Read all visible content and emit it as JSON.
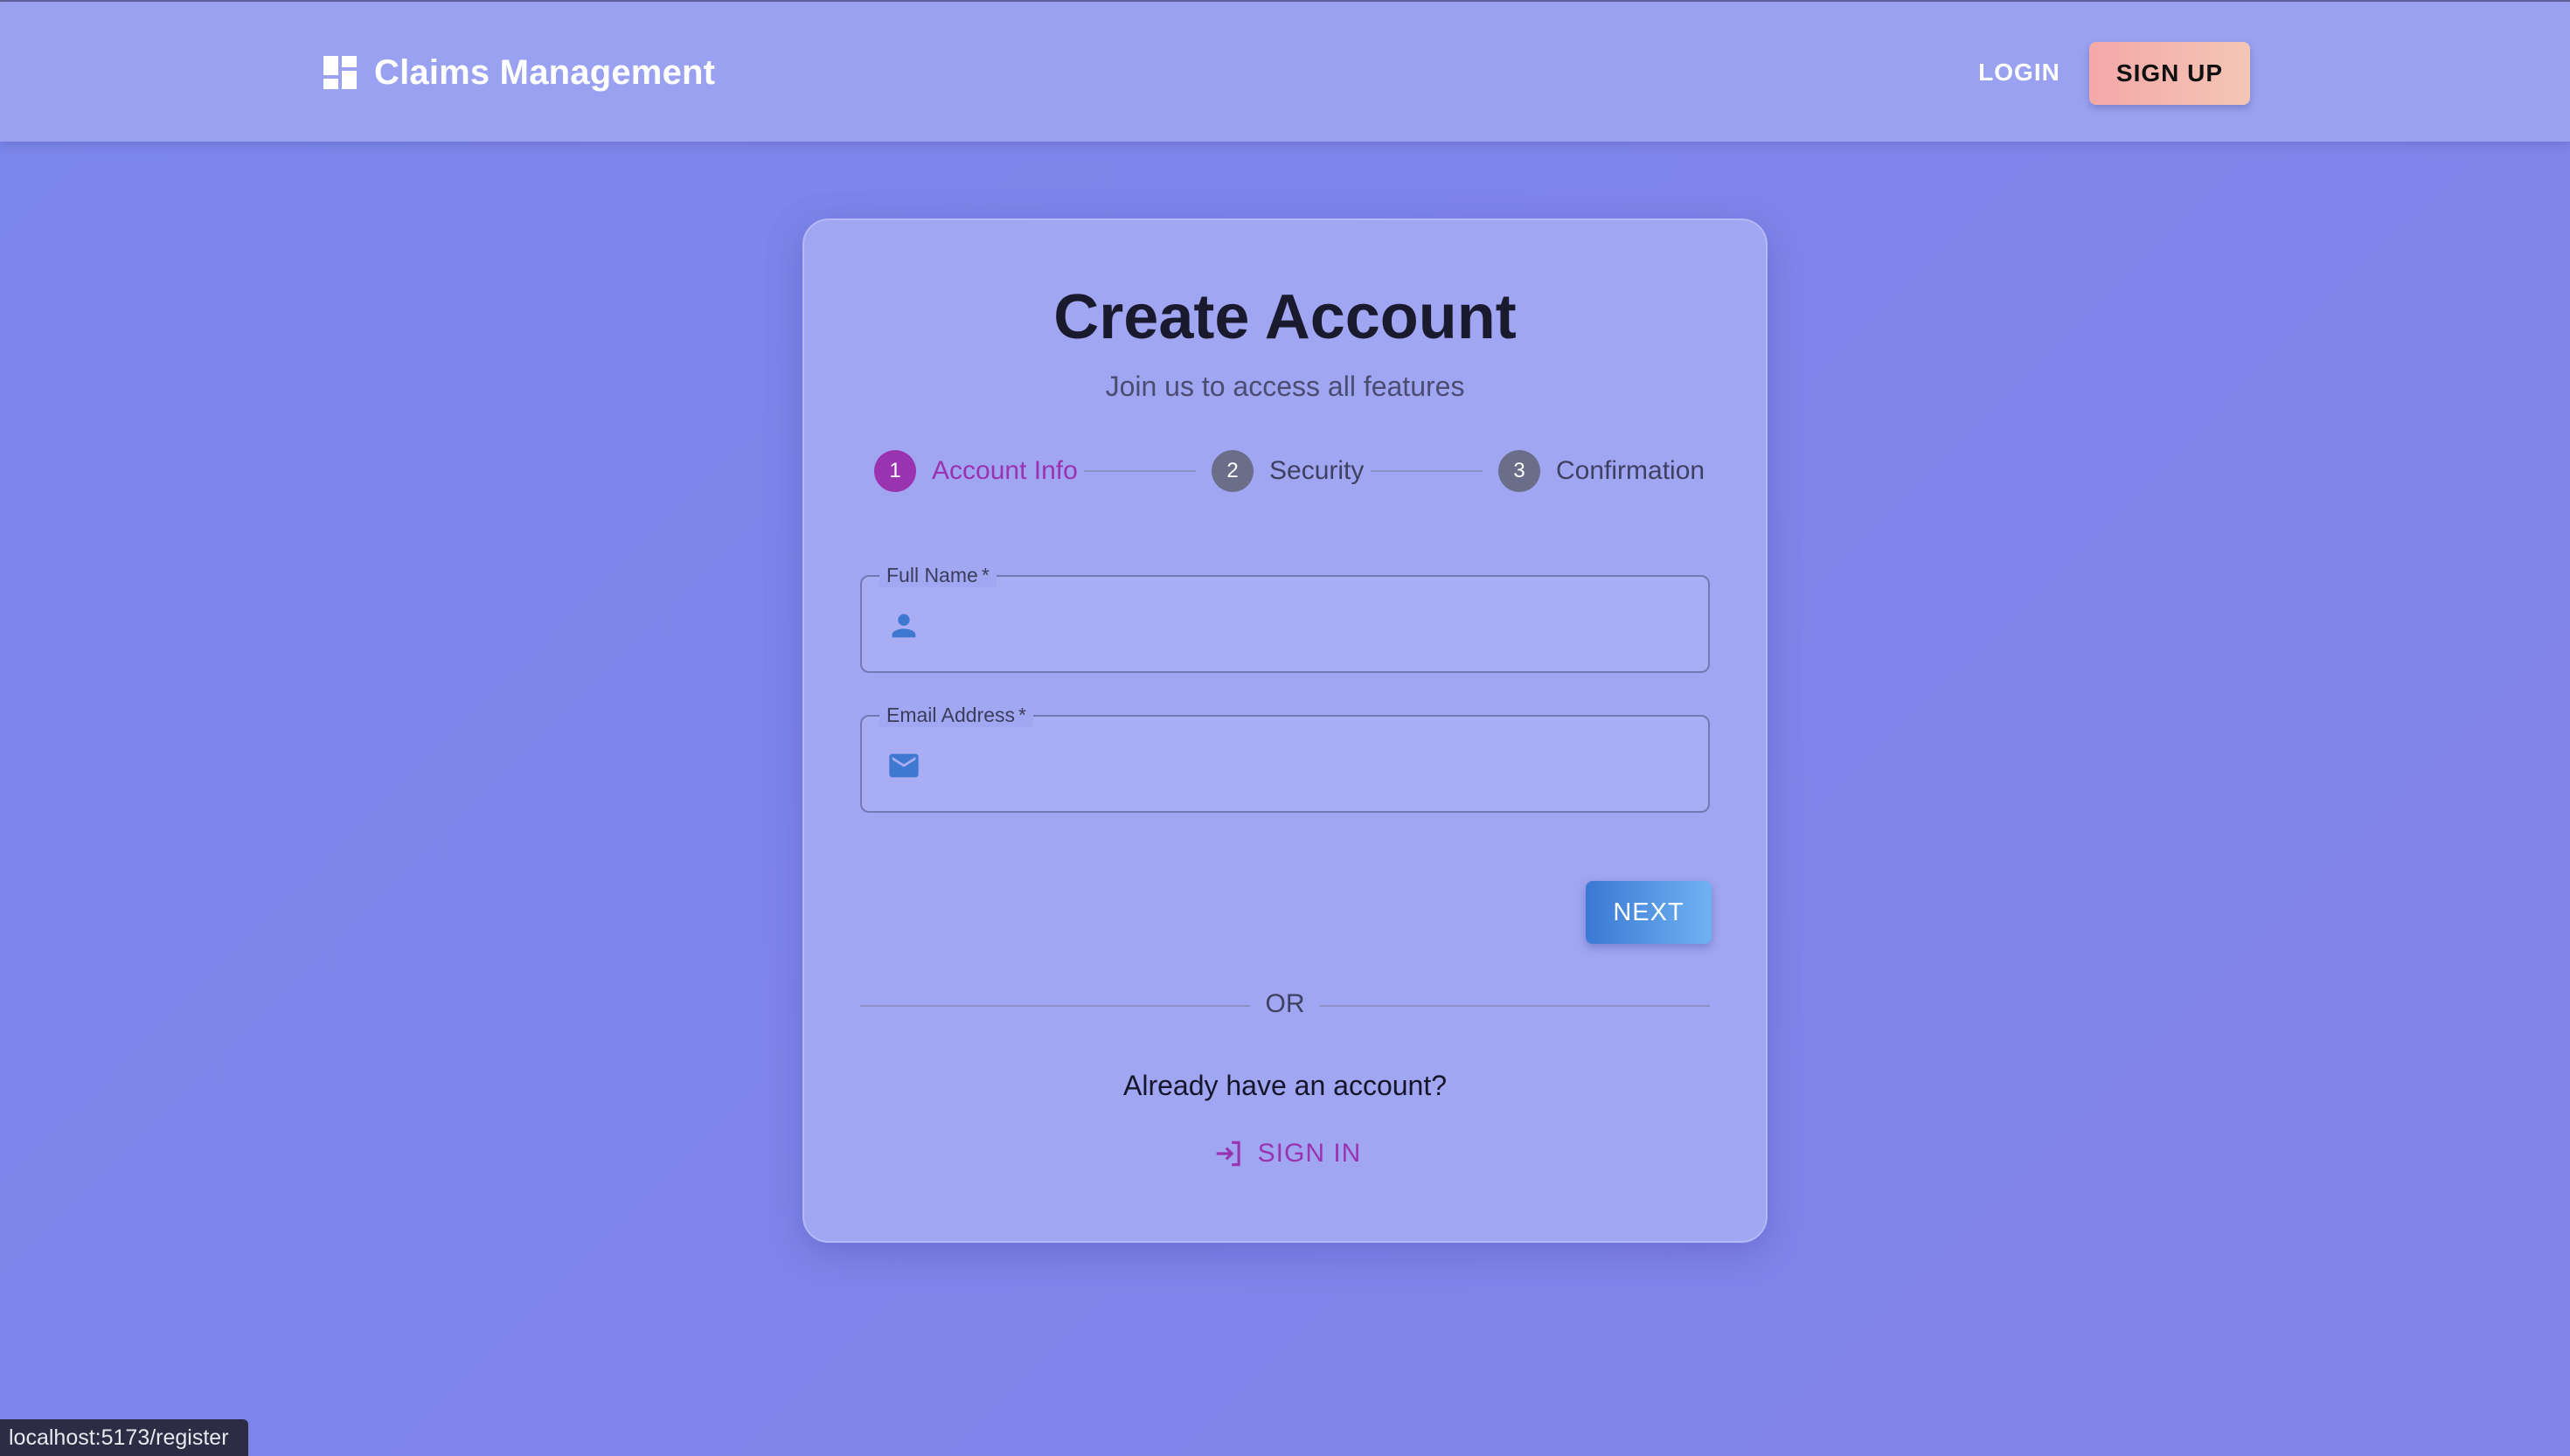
{
  "app": {
    "title": "Claims Management",
    "logo_icon": "dashboard-icon"
  },
  "nav": {
    "login_label": "LOGIN",
    "signup_label": "SIGN UP"
  },
  "card": {
    "title": "Create Account",
    "subtitle": "Join us to access all features"
  },
  "stepper": {
    "active_step": 1,
    "steps": [
      {
        "number": "1",
        "label": "Account Info"
      },
      {
        "number": "2",
        "label": "Security"
      },
      {
        "number": "3",
        "label": "Confirmation"
      }
    ]
  },
  "form": {
    "full_name": {
      "label": "Full Name",
      "required_mark": "*",
      "value": "",
      "icon": "person-icon"
    },
    "email": {
      "label": "Email Address",
      "required_mark": "*",
      "value": "",
      "icon": "mail-icon"
    },
    "next_label": "NEXT"
  },
  "divider_text": "OR",
  "signin": {
    "prompt": "Already have an account?",
    "label": "SIGN IN",
    "icon": "login-icon"
  },
  "status_bar": {
    "url": "localhost:5173/register"
  },
  "colors": {
    "accent_purple": "#9a33b0",
    "primary_blue": "#3a78d4",
    "signup_peach": "#f4b4ad",
    "background": "#7f85ea"
  }
}
